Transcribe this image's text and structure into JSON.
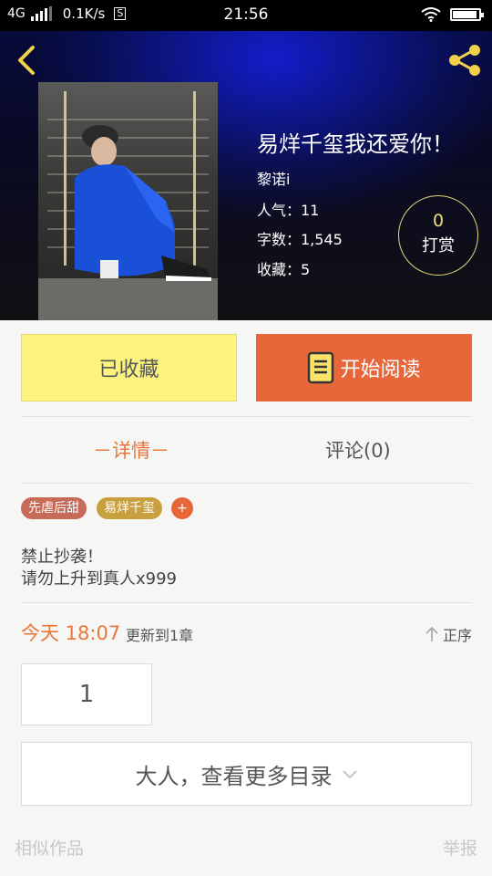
{
  "status_bar": {
    "network": "4G",
    "speed": "0.1K/s",
    "s_badge": "S",
    "time": "21:56"
  },
  "header": {
    "back_icon": "chevron-left-icon",
    "share_icon": "share-icon",
    "title": "易烊千玺我还爱你！",
    "author": "黎诺i",
    "popularity": "人气：11",
    "word_count": "字数：1,545",
    "favorites": "收藏：5",
    "tip": {
      "count": "0",
      "label": "打赏"
    }
  },
  "actions": {
    "collected_label": "已收藏",
    "read_label": "开始阅读",
    "read_icon": "book-icon"
  },
  "tabs": {
    "detail": "－详情－",
    "comment": "评论(0)"
  },
  "tags": [
    "先虐后甜",
    "易烊千玺",
    "+"
  ],
  "description": [
    "禁止抄袭！",
    "请勿上升到真人x999"
  ],
  "update": {
    "time": "今天 18:07",
    "text": "更新到1章",
    "order_label": "正序"
  },
  "chapter_number": "1",
  "more_catalog": "大人，查看更多目录",
  "footer": {
    "similar": "相似作品",
    "report": "举报"
  },
  "colors": {
    "accent_orange": "#e8673a",
    "collected_yellow": "#fcf37f",
    "tip_gold": "#f0dc7a"
  }
}
